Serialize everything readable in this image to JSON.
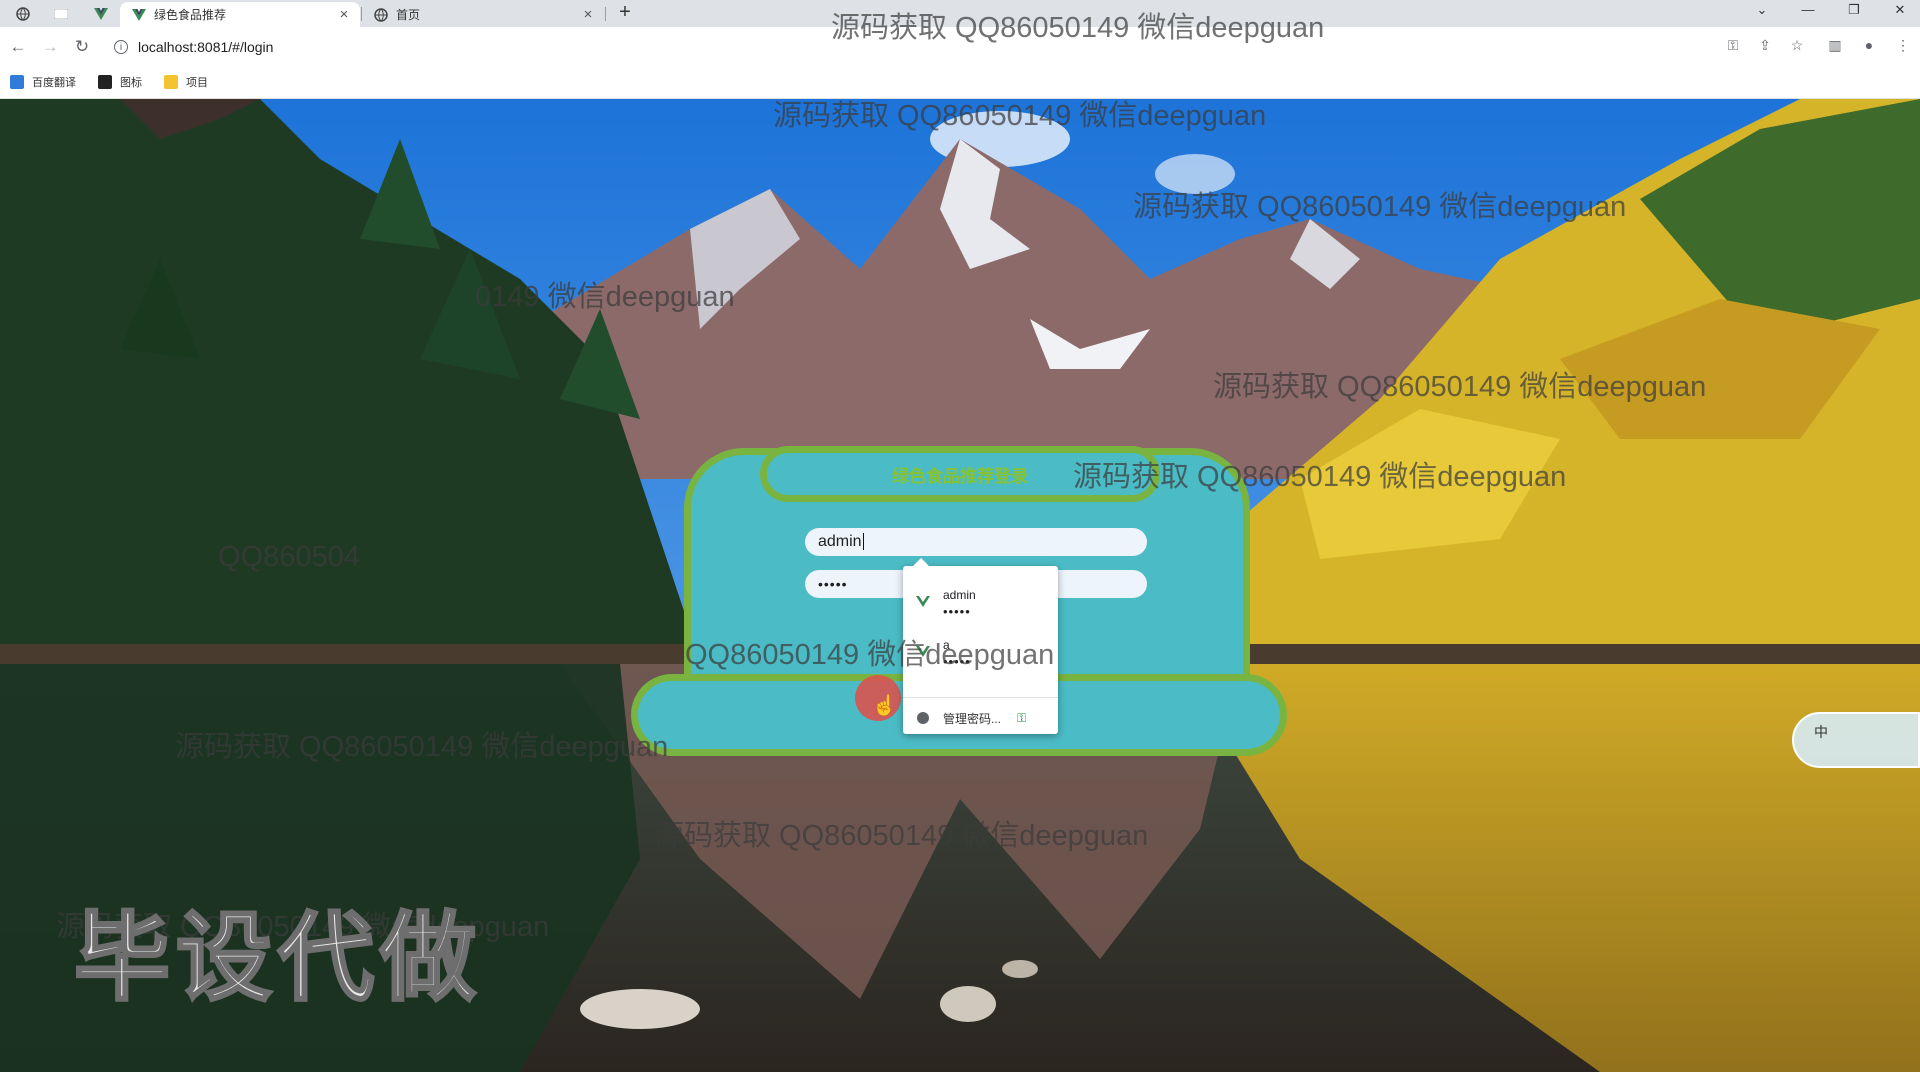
{
  "browser": {
    "tabs": [
      {
        "title": "绿色食品推荐",
        "active": true
      },
      {
        "title": "首页",
        "active": false
      }
    ],
    "url": "localhost:8081/#/login",
    "bookmarks": [
      "百度翻译",
      "图标",
      "项目"
    ]
  },
  "login": {
    "title": "绿色食品推荐登录",
    "username_value": "admin",
    "password_value": "•••••"
  },
  "autofill": {
    "entries": [
      {
        "user": "admin",
        "password": "•••••"
      },
      {
        "user": "a",
        "password": "•••••"
      }
    ],
    "manage_label": "管理密码..."
  },
  "watermarks": [
    "源码获取 QQ86050149 微信deepguan",
    "源码获取 QQ86050149 微信deepguan",
    "源码获取 QQ86050149 微信deepguan",
    "0149 微信deepguan",
    "源码获取 QQ86050149 微信deepguan",
    "源码获取 QQ86050149 微信deepguan",
    "QQ86050149 微信deepguan",
    "源码获取 QQ86050149 微信deepguan",
    "源码获取 QQ86050149 微信deepguan",
    "源码获取 QQ86050149 微信deepguan",
    "QQ860504"
  ],
  "stamp": "毕设代做",
  "ime": "中",
  "colors": {
    "panel_fill": "#4bbcc6",
    "panel_border": "#79b340",
    "title_text": "#86c232",
    "login_button": "#d9534f"
  }
}
